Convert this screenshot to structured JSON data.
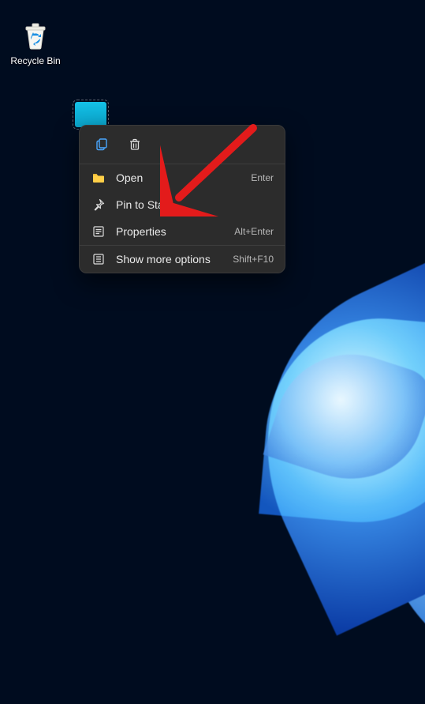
{
  "desktop": {
    "recycle_bin_label": "Recycle Bin"
  },
  "context_menu": {
    "items": {
      "open": {
        "label": "Open",
        "shortcut": "Enter"
      },
      "pin_start": {
        "label": "Pin to Start",
        "shortcut": ""
      },
      "properties": {
        "label": "Properties",
        "shortcut": "Alt+Enter"
      },
      "more": {
        "label": "Show more options",
        "shortcut": "Shift+F10"
      }
    }
  },
  "colors": {
    "accent": "#0aa4cb",
    "menu_bg": "#2c2c2c",
    "arrow": "#e31b1b"
  }
}
